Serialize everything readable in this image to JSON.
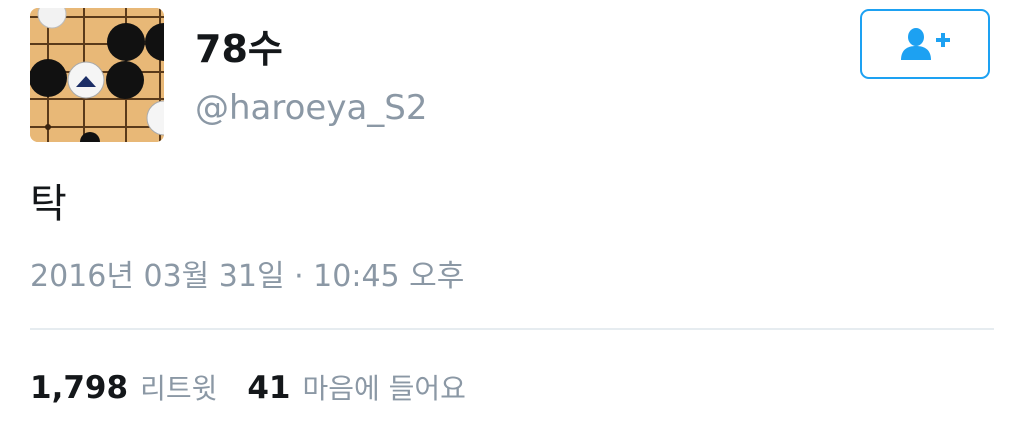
{
  "user": {
    "display_name": "78수",
    "screen_name": "@haroeya_S2",
    "avatar_icon": "go-board-avatar"
  },
  "follow_button": {
    "icon": "add-user-icon",
    "accent_color": "#1da1f2"
  },
  "tweet": {
    "text": "탁",
    "timestamp": "2016년 03월 31일 · 10:45 오후"
  },
  "stats": {
    "retweets_count": "1,798",
    "retweets_label": "리트윗",
    "likes_count": "41",
    "likes_label": "마음에 들어요"
  }
}
